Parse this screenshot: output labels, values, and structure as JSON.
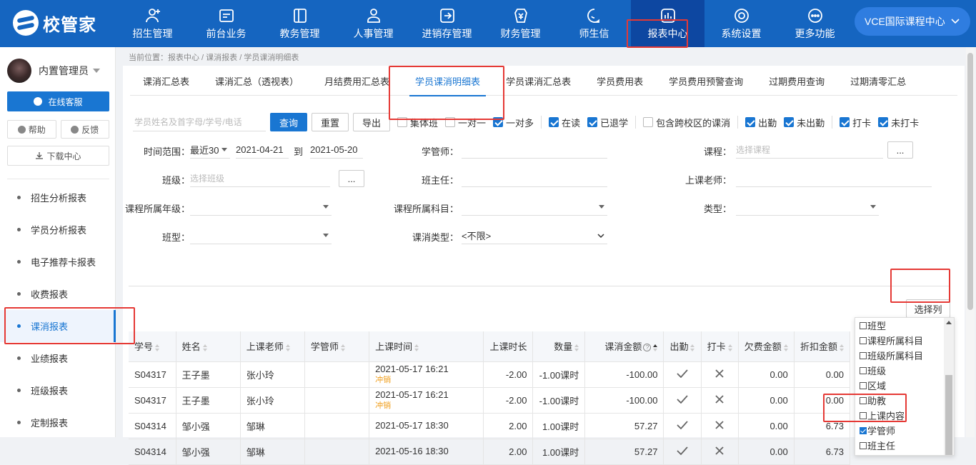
{
  "brand": {
    "name": "校管家"
  },
  "nav": [
    {
      "label": "招生管理",
      "icon": "user-add-icon"
    },
    {
      "label": "前台业务",
      "icon": "desk-icon"
    },
    {
      "label": "教务管理",
      "icon": "book-icon"
    },
    {
      "label": "人事管理",
      "icon": "person-icon"
    },
    {
      "label": "进销存管理",
      "icon": "inventory-icon"
    },
    {
      "label": "财务管理",
      "icon": "finance-icon"
    },
    {
      "label": "师生信",
      "icon": "message-icon"
    },
    {
      "label": "报表中心",
      "icon": "report-icon",
      "active": true
    },
    {
      "label": "系统设置",
      "icon": "settings-icon"
    },
    {
      "label": "更多功能",
      "icon": "more-icon"
    }
  ],
  "school": {
    "name": "VCE国际课程中心"
  },
  "sidebar": {
    "user": "内置管理员",
    "kefu": "在线客服",
    "help": "帮助",
    "feedback": "反馈",
    "download": "下载中心",
    "items": [
      {
        "label": "招生分析报表"
      },
      {
        "label": "学员分析报表"
      },
      {
        "label": "电子推荐卡报表"
      },
      {
        "label": "收费报表"
      },
      {
        "label": "课消报表",
        "active": true
      },
      {
        "label": "业绩报表"
      },
      {
        "label": "班级报表"
      },
      {
        "label": "定制报表"
      }
    ]
  },
  "breadcrumb": "当前位置：报表中心 / 课消报表 / 学员课消明细表",
  "tabs": [
    {
      "label": "课消汇总表"
    },
    {
      "label": "课消汇总（透视表）"
    },
    {
      "label": "月结费用汇总表"
    },
    {
      "label": "学员课消明细表",
      "active": true
    },
    {
      "label": "学员课消汇总表"
    },
    {
      "label": "学员费用表"
    },
    {
      "label": "学员费用预警查询"
    },
    {
      "label": "过期费用查询"
    },
    {
      "label": "过期清零汇总"
    }
  ],
  "search": {
    "placeholder": "学员姓名及首字母/学号/电话"
  },
  "buttons": {
    "query": "查询",
    "reset": "重置",
    "export": "导出",
    "select_cols": "选择列",
    "more": "..."
  },
  "checks": {
    "group1": [
      {
        "label": "集体班",
        "checked": false
      },
      {
        "label": "一对一",
        "checked": false
      },
      {
        "label": "一对多",
        "checked": true
      }
    ],
    "group2": [
      {
        "label": "在读",
        "checked": true
      },
      {
        "label": "已退学",
        "checked": true
      }
    ],
    "cross": {
      "label": "包含跨校区的课消",
      "checked": false
    },
    "group3": [
      {
        "label": "出勤",
        "checked": true
      },
      {
        "label": "未出勤",
        "checked": true
      }
    ],
    "group4": [
      {
        "label": "打卡",
        "checked": true
      },
      {
        "label": "未打卡",
        "checked": true
      }
    ]
  },
  "filters": {
    "time_label": "时间范围：",
    "time_preset": "最近30",
    "date_from": "2021-04-21",
    "to": "到",
    "date_to": "2021-05-20",
    "advisor_label": "学管师：",
    "course_label": "课程：",
    "course_ph": "选择课程",
    "class_label": "班级：",
    "class_ph": "选择班级",
    "headteacher_label": "班主任：",
    "teacher_label": "上课老师：",
    "grade_label": "课程所属年级：",
    "subject_label": "课程所属科目：",
    "type_label": "类型：",
    "classtype_label": "班型：",
    "consume_label": "课消类型：",
    "consume_value": "<不限>"
  },
  "table": {
    "headers": [
      "学号",
      "姓名",
      "上课老师",
      "学管师",
      "上课时间",
      "上课时长",
      "数量",
      "课消金额",
      "出勤",
      "打卡",
      "欠费金额",
      "折扣金额"
    ],
    "rows": [
      {
        "id": "S04317",
        "name": "王子墨",
        "teacher": "张小玲",
        "advisor": "",
        "time": "2021-05-17 16:21",
        "tag": "冲销",
        "duration": "-2.00",
        "qty": "-1.00课时",
        "amount": "-100.00",
        "owe": "0.00",
        "discount": "0.00"
      },
      {
        "id": "S04317",
        "name": "王子墨",
        "teacher": "张小玲",
        "advisor": "",
        "time": "2021-05-17 16:21",
        "tag": "冲销",
        "duration": "-2.00",
        "qty": "-1.00课时",
        "amount": "-100.00",
        "owe": "0.00",
        "discount": "0.00"
      },
      {
        "id": "S04314",
        "name": "邹小强",
        "teacher": "邹琳",
        "advisor": "",
        "time": "2021-05-17 18:30",
        "tag": "",
        "duration": "2.00",
        "qty": "1.00课时",
        "amount": "57.27",
        "owe": "0.00",
        "discount": "6.73"
      },
      {
        "id": "S04314",
        "name": "邹小强",
        "teacher": "邹琳",
        "advisor": "",
        "time": "2021-05-16 18:30",
        "tag": "",
        "duration": "2.00",
        "qty": "1.00课时",
        "amount": "57.27",
        "owe": "0.00",
        "discount": "6.73"
      }
    ]
  },
  "column_picker": [
    {
      "label": "班型",
      "checked": false
    },
    {
      "label": "课程所属科目",
      "checked": false
    },
    {
      "label": "班级所属科目",
      "checked": false
    },
    {
      "label": "班级",
      "checked": false
    },
    {
      "label": "区域",
      "checked": false
    },
    {
      "label": "助教",
      "checked": false
    },
    {
      "label": "上课内容",
      "checked": false
    },
    {
      "label": "学管师",
      "checked": true
    },
    {
      "label": "班主任",
      "checked": false
    }
  ],
  "colors": {
    "primary": "#1565c0",
    "accent": "#1976d2",
    "highlight": "#e53935",
    "tag": "#f0a020"
  }
}
